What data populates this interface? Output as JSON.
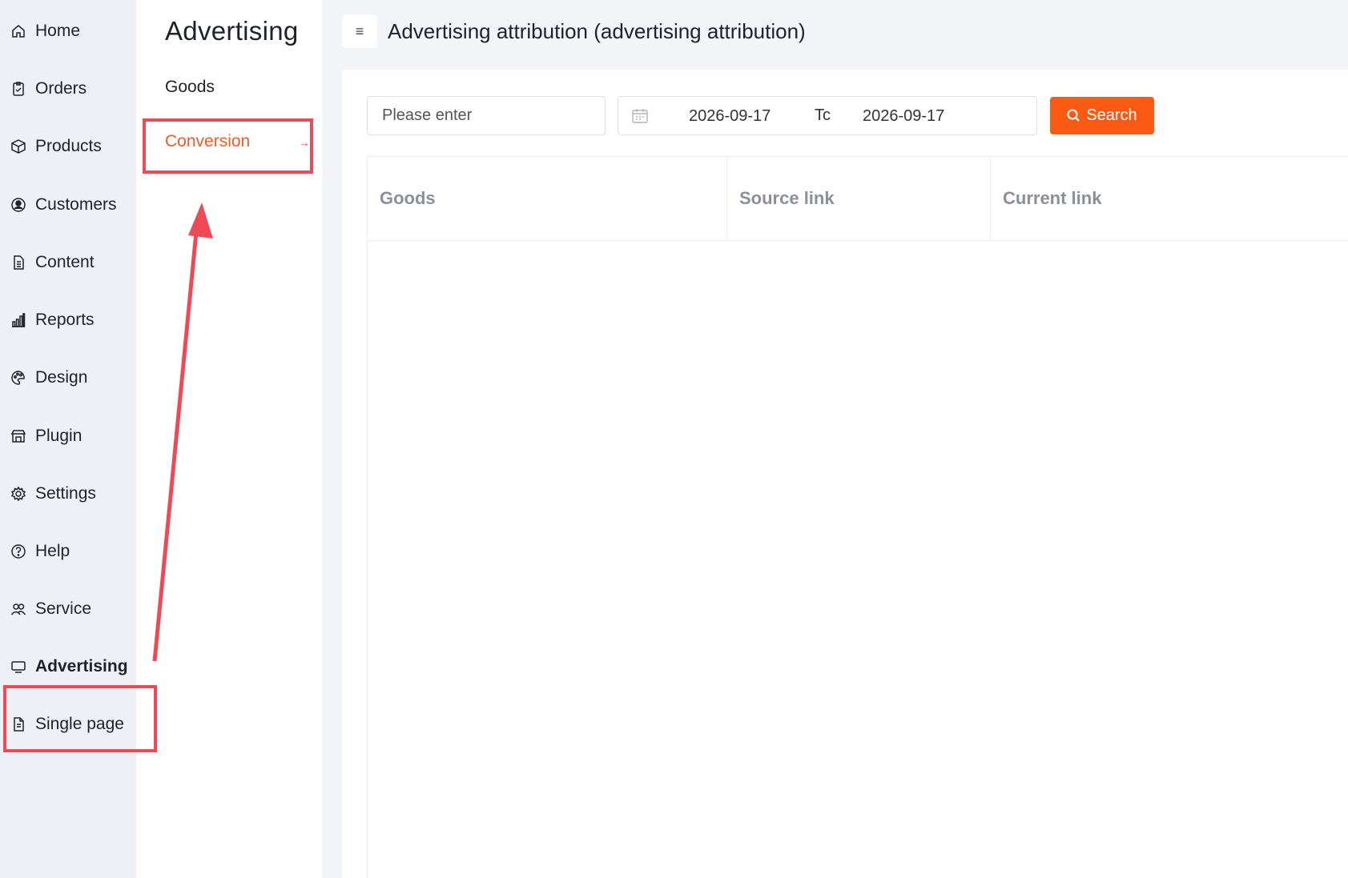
{
  "main_nav": {
    "items": [
      {
        "label": "Home",
        "icon": "home-icon"
      },
      {
        "label": "Orders",
        "icon": "clipboard-icon"
      },
      {
        "label": "Products",
        "icon": "box-icon"
      },
      {
        "label": "Customers",
        "icon": "user-circle-icon"
      },
      {
        "label": "Content",
        "icon": "document-icon"
      },
      {
        "label": "Reports",
        "icon": "bar-chart-icon"
      },
      {
        "label": "Design",
        "icon": "palette-icon"
      },
      {
        "label": "Plugin",
        "icon": "store-icon"
      },
      {
        "label": "Settings",
        "icon": "gear-icon"
      },
      {
        "label": "Help",
        "icon": "question-circle-icon"
      },
      {
        "label": "Service",
        "icon": "users-icon"
      },
      {
        "label": "Advertising",
        "icon": "monitor-icon",
        "active": true
      },
      {
        "label": "Single page",
        "icon": "page-icon"
      }
    ]
  },
  "sub_nav": {
    "title": "Advertising",
    "items": [
      {
        "label": "Goods"
      },
      {
        "label": "Conversion",
        "active": true
      }
    ]
  },
  "header": {
    "menu_icon": "menu-icon",
    "title": "Advertising attribution (advertising attribution)"
  },
  "filters": {
    "search_placeholder": "Please enter",
    "date_start": "2026-09-17",
    "date_separator": "Tc",
    "date_end": "2026-09-17",
    "search_button": "Search"
  },
  "table": {
    "columns": [
      "Goods",
      "Source link",
      "Current link"
    ],
    "rows": []
  },
  "colors": {
    "accent": "#fb5a14",
    "active_text": "#f05b23",
    "annotation": "#ee4a55",
    "sidebar_bg": "#edf0f5"
  }
}
